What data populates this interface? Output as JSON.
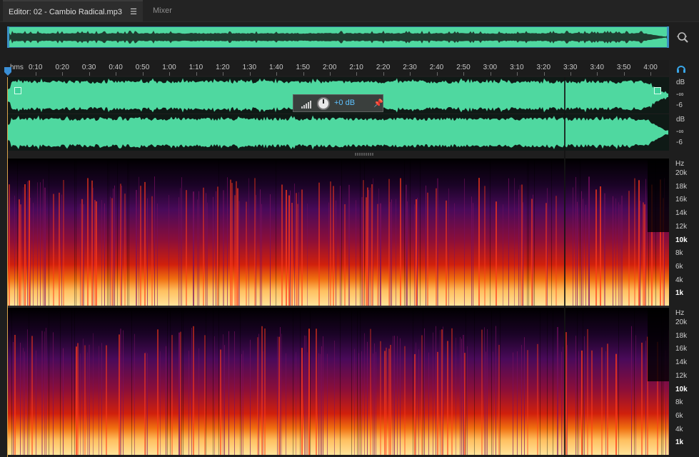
{
  "tabs": [
    {
      "label": "Editor: 02 - Cambio Radical.mp3",
      "active": true,
      "menu_icon": "hamburger-icon"
    },
    {
      "label": "Mixer",
      "active": false
    }
  ],
  "overview": {
    "color": "#4fd8a0",
    "zoom_icon": "zoom-icon"
  },
  "timeline": {
    "unit_label": "hms",
    "ticks": [
      "0:10",
      "0:20",
      "0:30",
      "0:40",
      "0:50",
      "1:00",
      "1:10",
      "1:20",
      "1:30",
      "1:40",
      "1:50",
      "2:00",
      "2:10",
      "2:20",
      "2:30",
      "2:40",
      "2:50",
      "3:00",
      "3:10",
      "3:20",
      "3:30",
      "3:40",
      "3:50",
      "4:00"
    ],
    "right_icon": "headphones-icon"
  },
  "waveform": {
    "color": "#4fd8a0",
    "scale_ch1": {
      "unit": "dB",
      "top": "-∞",
      "bottom": "-6"
    },
    "scale_ch2": {
      "unit": "dB",
      "top": "-∞",
      "bottom": "-6"
    }
  },
  "hud": {
    "value": "+0 dB",
    "meter_icon": "level-meter-icon",
    "knob_icon": "volume-knob-icon",
    "pin_icon": "pin-icon"
  },
  "spectral": {
    "unit": "Hz",
    "labels": [
      "20k",
      "18k",
      "16k",
      "14k",
      "12k",
      "10k",
      "8k",
      "6k",
      "4k",
      "1k"
    ],
    "bold_labels": [
      "10k",
      "1k"
    ]
  }
}
